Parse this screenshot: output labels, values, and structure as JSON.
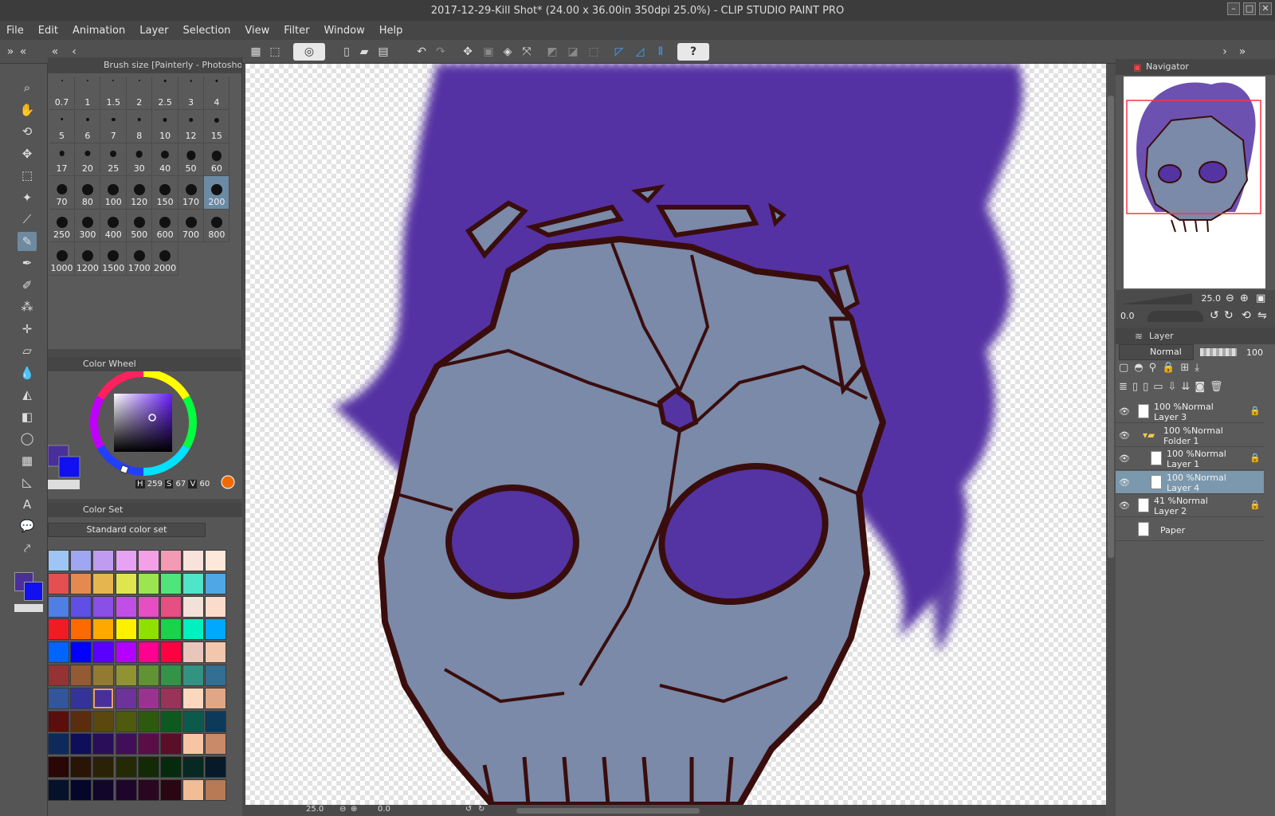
{
  "window": {
    "title": "2017-12-29-Kill Shot* (24.00 x 36.00in 350dpi 25.0%) - CLIP STUDIO PAINT PRO"
  },
  "menu": [
    "File",
    "Edit",
    "Animation",
    "Layer",
    "Selection",
    "View",
    "Filter",
    "Window",
    "Help"
  ],
  "tools": [
    "zoom-icon",
    "hand-icon",
    "rotate-icon",
    "move-icon",
    "selection-rect-icon",
    "magic-wand-icon",
    "eyedropper-icon",
    "brush-icon",
    "pen-icon",
    "airbrush-icon",
    "spray-icon",
    "decoration-icon",
    "eraser-icon",
    "blend-icon",
    "fill-icon",
    "gradient-icon",
    "ellipse-icon",
    "frame-icon",
    "ruler-icon",
    "text-icon",
    "balloon-icon",
    "correct-line-icon"
  ],
  "brush_panel": {
    "title": "Brush size [Painterly - Photoshop Ro",
    "sizes": [
      "0.7",
      "1",
      "1.5",
      "2",
      "2.5",
      "3",
      "4",
      "5",
      "6",
      "7",
      "8",
      "10",
      "12",
      "15",
      "17",
      "20",
      "25",
      "30",
      "40",
      "50",
      "60",
      "70",
      "80",
      "100",
      "120",
      "150",
      "170",
      "200",
      "250",
      "300",
      "400",
      "500",
      "600",
      "700",
      "800",
      "1000",
      "1200",
      "1500",
      "1700",
      "2000"
    ],
    "selected": "200"
  },
  "color_wheel": {
    "title": "Color Wheel",
    "h_label": "H",
    "h": "259",
    "s_label": "S",
    "s": "67",
    "v_label": "V",
    "v": "60",
    "main_color": "#4a2f9a",
    "sub_color": "#1010f0"
  },
  "color_set": {
    "title": "Color Set",
    "selected_set": "Standard color set",
    "rows": [
      [
        "#9ec5f5",
        "#9fa7f2",
        "#c09cf0",
        "#e7a2f3",
        "#f59fe6",
        "#f49ab5",
        "#f9e2dc",
        "#fde8d9"
      ],
      [
        "#e54f4f",
        "#e58a4f",
        "#e5b54f",
        "#dfe54f",
        "#9be54f",
        "#4fe57a",
        "#4fe5c8",
        "#4fa8e5"
      ],
      [
        "#4f7ee5",
        "#5f4fe5",
        "#8a4fe5",
        "#c24fe5",
        "#e54fc2",
        "#e54f82",
        "#f3e0d8",
        "#fbdccb"
      ],
      [
        "#ef1c24",
        "#ff6a00",
        "#ffa800",
        "#fff000",
        "#8ee000",
        "#19d34a",
        "#00f0c0",
        "#00a8ff"
      ],
      [
        "#0064ff",
        "#0000ff",
        "#5a00ff",
        "#b400ff",
        "#ff0090",
        "#ff0040",
        "#e9c6bb",
        "#f2c7ad"
      ],
      [
        "#933333",
        "#935a33",
        "#937a33",
        "#8f9333",
        "#609333",
        "#339346",
        "#339383",
        "#336f93"
      ],
      [
        "#33559a",
        "#33339a",
        "#4a2f9a",
        "#6e339a",
        "#9a3390",
        "#9a3358",
        "#fbd7bd",
        "#e0a787"
      ],
      [
        "#5a0e0e",
        "#5a2d0e",
        "#5a480e",
        "#4e5a0e",
        "#2d5a0e",
        "#0e5a1e",
        "#0e5a4a",
        "#0e3a5a"
      ],
      [
        "#0e2a5a",
        "#0e0e5a",
        "#2a0e5a",
        "#420e5a",
        "#5a0e48",
        "#5a0e28",
        "#f7c5a3",
        "#c98a6a"
      ],
      [
        "#2a0606",
        "#2a1406",
        "#2a2206",
        "#242a06",
        "#142a06",
        "#062a0e",
        "#062a22",
        "#061a2a"
      ],
      [
        "#06122a",
        "#06062a",
        "#12062a",
        "#1e062a",
        "#2a0620",
        "#2a0612",
        "#f2bc94",
        "#b77a55"
      ]
    ],
    "selected_index": "6.2"
  },
  "navigator": {
    "title": "Navigator",
    "zoom": "25.0",
    "rotation": "0.0"
  },
  "layer_panel": {
    "title": "Layer",
    "blend_mode": "Normal",
    "opacity": "100",
    "layers": [
      {
        "line1": "100 %Normal",
        "line2": "Layer 3",
        "indent": 0,
        "locked": true,
        "selected": false,
        "visible": true
      },
      {
        "line1": "100 %Normal",
        "line2": "Folder 1",
        "indent": 1,
        "locked": false,
        "selected": false,
        "visible": true,
        "folder": true
      },
      {
        "line1": "100 %Normal",
        "line2": "Layer 1",
        "indent": 2,
        "locked": true,
        "selected": false,
        "visible": true
      },
      {
        "line1": "100 %Normal",
        "line2": "Layer 4",
        "indent": 2,
        "locked": false,
        "selected": true,
        "visible": true
      },
      {
        "line1": "41 %Normal",
        "line2": "Layer 2",
        "indent": 0,
        "locked": true,
        "selected": false,
        "visible": true
      },
      {
        "line1": "",
        "line2": "Paper",
        "indent": 0,
        "locked": false,
        "selected": false,
        "visible": false,
        "paper": true
      }
    ]
  },
  "status": {
    "zoom": "25.0",
    "rotation": "0.0"
  },
  "colors": {
    "flame": "#5433a3",
    "skull": "#7a8aa8",
    "ink": "#3a0d0d",
    "selection": "#7b98ad"
  }
}
